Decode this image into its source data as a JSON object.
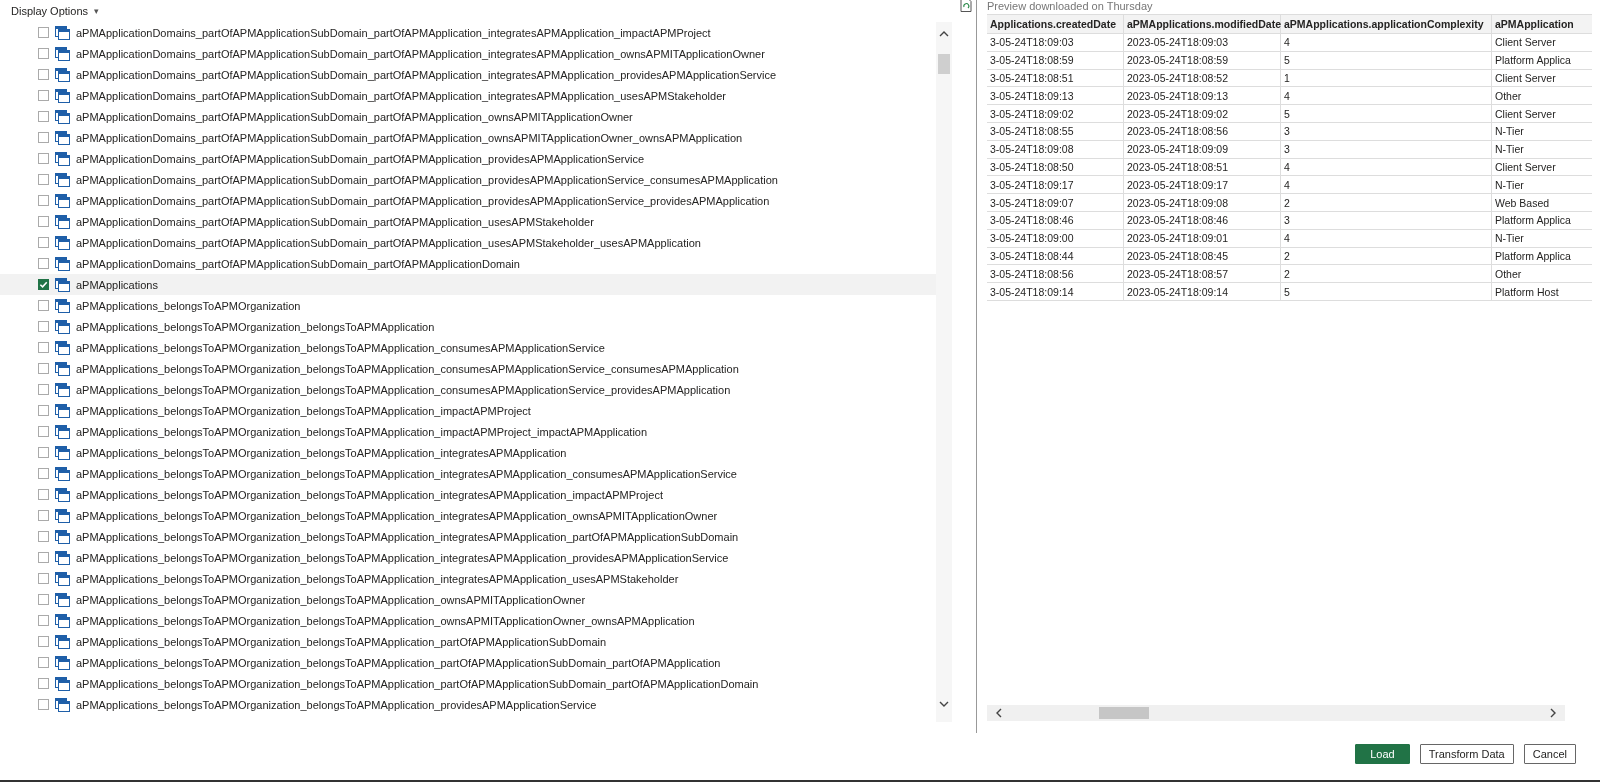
{
  "display_options": {
    "label": "Display Options",
    "caret": "▾"
  },
  "tree": {
    "items": [
      {
        "name": "aPMApplicationDomains_partOfAPMApplicationSubDomain_partOfAPMApplication_integratesAPMApplication_impactAPMProject",
        "checked": false,
        "selected": false
      },
      {
        "name": "aPMApplicationDomains_partOfAPMApplicationSubDomain_partOfAPMApplication_integratesAPMApplication_ownsAPMITApplicationOwner",
        "checked": false,
        "selected": false
      },
      {
        "name": "aPMApplicationDomains_partOfAPMApplicationSubDomain_partOfAPMApplication_integratesAPMApplication_providesAPMApplicationService",
        "checked": false,
        "selected": false
      },
      {
        "name": "aPMApplicationDomains_partOfAPMApplicationSubDomain_partOfAPMApplication_integratesAPMApplication_usesAPMStakeholder",
        "checked": false,
        "selected": false
      },
      {
        "name": "aPMApplicationDomains_partOfAPMApplicationSubDomain_partOfAPMApplication_ownsAPMITApplicationOwner",
        "checked": false,
        "selected": false
      },
      {
        "name": "aPMApplicationDomains_partOfAPMApplicationSubDomain_partOfAPMApplication_ownsAPMITApplicationOwner_ownsAPMApplication",
        "checked": false,
        "selected": false
      },
      {
        "name": "aPMApplicationDomains_partOfAPMApplicationSubDomain_partOfAPMApplication_providesAPMApplicationService",
        "checked": false,
        "selected": false
      },
      {
        "name": "aPMApplicationDomains_partOfAPMApplicationSubDomain_partOfAPMApplication_providesAPMApplicationService_consumesAPMApplication",
        "checked": false,
        "selected": false
      },
      {
        "name": "aPMApplicationDomains_partOfAPMApplicationSubDomain_partOfAPMApplication_providesAPMApplicationService_providesAPMApplication",
        "checked": false,
        "selected": false
      },
      {
        "name": "aPMApplicationDomains_partOfAPMApplicationSubDomain_partOfAPMApplication_usesAPMStakeholder",
        "checked": false,
        "selected": false
      },
      {
        "name": "aPMApplicationDomains_partOfAPMApplicationSubDomain_partOfAPMApplication_usesAPMStakeholder_usesAPMApplication",
        "checked": false,
        "selected": false
      },
      {
        "name": "aPMApplicationDomains_partOfAPMApplicationSubDomain_partOfAPMApplicationDomain",
        "checked": false,
        "selected": false
      },
      {
        "name": "aPMApplications",
        "checked": true,
        "selected": true
      },
      {
        "name": "aPMApplications_belongsToAPMOrganization",
        "checked": false,
        "selected": false
      },
      {
        "name": "aPMApplications_belongsToAPMOrganization_belongsToAPMApplication",
        "checked": false,
        "selected": false
      },
      {
        "name": "aPMApplications_belongsToAPMOrganization_belongsToAPMApplication_consumesAPMApplicationService",
        "checked": false,
        "selected": false
      },
      {
        "name": "aPMApplications_belongsToAPMOrganization_belongsToAPMApplication_consumesAPMApplicationService_consumesAPMApplication",
        "checked": false,
        "selected": false
      },
      {
        "name": "aPMApplications_belongsToAPMOrganization_belongsToAPMApplication_consumesAPMApplicationService_providesAPMApplication",
        "checked": false,
        "selected": false
      },
      {
        "name": "aPMApplications_belongsToAPMOrganization_belongsToAPMApplication_impactAPMProject",
        "checked": false,
        "selected": false
      },
      {
        "name": "aPMApplications_belongsToAPMOrganization_belongsToAPMApplication_impactAPMProject_impactAPMApplication",
        "checked": false,
        "selected": false
      },
      {
        "name": "aPMApplications_belongsToAPMOrganization_belongsToAPMApplication_integratesAPMApplication",
        "checked": false,
        "selected": false
      },
      {
        "name": "aPMApplications_belongsToAPMOrganization_belongsToAPMApplication_integratesAPMApplication_consumesAPMApplicationService",
        "checked": false,
        "selected": false
      },
      {
        "name": "aPMApplications_belongsToAPMOrganization_belongsToAPMApplication_integratesAPMApplication_impactAPMProject",
        "checked": false,
        "selected": false
      },
      {
        "name": "aPMApplications_belongsToAPMOrganization_belongsToAPMApplication_integratesAPMApplication_ownsAPMITApplicationOwner",
        "checked": false,
        "selected": false
      },
      {
        "name": "aPMApplications_belongsToAPMOrganization_belongsToAPMApplication_integratesAPMApplication_partOfAPMApplicationSubDomain",
        "checked": false,
        "selected": false
      },
      {
        "name": "aPMApplications_belongsToAPMOrganization_belongsToAPMApplication_integratesAPMApplication_providesAPMApplicationService",
        "checked": false,
        "selected": false
      },
      {
        "name": "aPMApplications_belongsToAPMOrganization_belongsToAPMApplication_integratesAPMApplication_usesAPMStakeholder",
        "checked": false,
        "selected": false
      },
      {
        "name": "aPMApplications_belongsToAPMOrganization_belongsToAPMApplication_ownsAPMITApplicationOwner",
        "checked": false,
        "selected": false
      },
      {
        "name": "aPMApplications_belongsToAPMOrganization_belongsToAPMApplication_ownsAPMITApplicationOwner_ownsAPMApplication",
        "checked": false,
        "selected": false
      },
      {
        "name": "aPMApplications_belongsToAPMOrganization_belongsToAPMApplication_partOfAPMApplicationSubDomain",
        "checked": false,
        "selected": false
      },
      {
        "name": "aPMApplications_belongsToAPMOrganization_belongsToAPMApplication_partOfAPMApplicationSubDomain_partOfAPMApplication",
        "checked": false,
        "selected": false
      },
      {
        "name": "aPMApplications_belongsToAPMOrganization_belongsToAPMApplication_partOfAPMApplicationSubDomain_partOfAPMApplicationDomain",
        "checked": false,
        "selected": false
      },
      {
        "name": "aPMApplications_belongsToAPMOrganization_belongsToAPMApplication_providesAPMApplicationService",
        "checked": false,
        "selected": false
      }
    ]
  },
  "preview": {
    "caption": "Preview downloaded on Thursday",
    "table": {
      "columns": [
        "Applications.createdDate",
        "aPMApplications.modifiedDate",
        "aPMApplications.applicationComplexity",
        "aPMApplication"
      ],
      "rows": [
        [
          "3-05-24T18:09:03",
          "2023-05-24T18:09:03",
          "4",
          "Client Server"
        ],
        [
          "3-05-24T18:08:59",
          "2023-05-24T18:08:59",
          "5",
          "Platform Applica"
        ],
        [
          "3-05-24T18:08:51",
          "2023-05-24T18:08:52",
          "1",
          "Client Server"
        ],
        [
          "3-05-24T18:09:13",
          "2023-05-24T18:09:13",
          "4",
          "Other"
        ],
        [
          "3-05-24T18:09:02",
          "2023-05-24T18:09:02",
          "5",
          "Client Server"
        ],
        [
          "3-05-24T18:08:55",
          "2023-05-24T18:08:56",
          "3",
          "N-Tier"
        ],
        [
          "3-05-24T18:09:08",
          "2023-05-24T18:09:09",
          "3",
          "N-Tier"
        ],
        [
          "3-05-24T18:08:50",
          "2023-05-24T18:08:51",
          "4",
          "Client Server"
        ],
        [
          "3-05-24T18:09:17",
          "2023-05-24T18:09:17",
          "4",
          "N-Tier"
        ],
        [
          "3-05-24T18:09:07",
          "2023-05-24T18:09:08",
          "2",
          "Web Based"
        ],
        [
          "3-05-24T18:08:46",
          "2023-05-24T18:08:46",
          "3",
          "Platform Applica"
        ],
        [
          "3-05-24T18:09:00",
          "2023-05-24T18:09:01",
          "4",
          "N-Tier"
        ],
        [
          "3-05-24T18:08:44",
          "2023-05-24T18:08:45",
          "2",
          "Platform Applica"
        ],
        [
          "3-05-24T18:08:56",
          "2023-05-24T18:08:57",
          "2",
          "Other"
        ],
        [
          "3-05-24T18:09:14",
          "2023-05-24T18:09:14",
          "5",
          "Platform Host"
        ]
      ]
    }
  },
  "buttons": [
    {
      "label": "Load",
      "kind": "primary"
    },
    {
      "label": "Transform Data",
      "kind": "secondary"
    },
    {
      "label": "Cancel",
      "kind": "secondary"
    }
  ]
}
